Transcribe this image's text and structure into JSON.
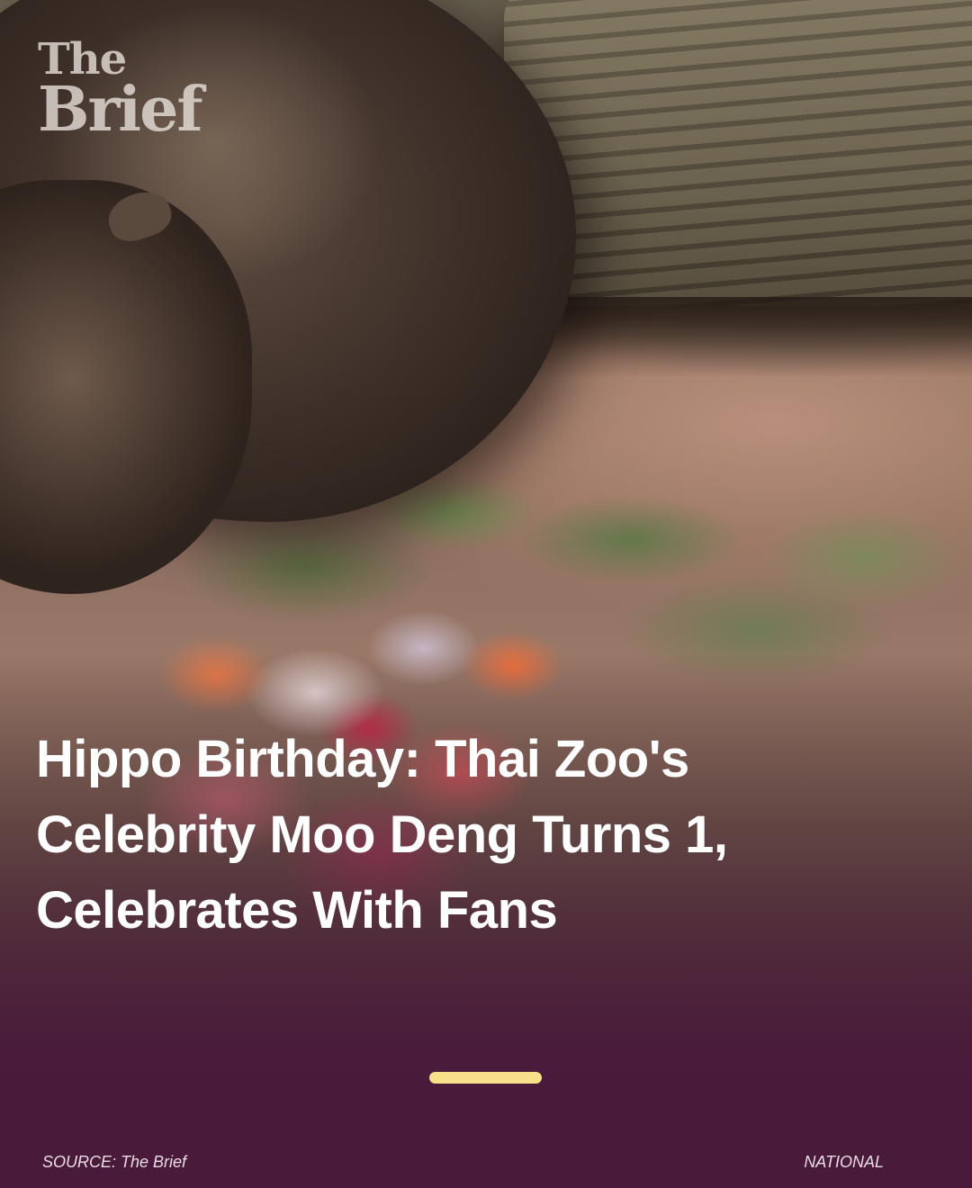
{
  "brand": {
    "logo_line1": "The",
    "logo_line2": "Brief"
  },
  "article": {
    "headline_lines": [
      "Hippo Birthday: Thai Zoo's",
      "Celebrity Moo Deng Turns 1,",
      "Celebrates With Fans"
    ]
  },
  "footer": {
    "source": "SOURCE: The Brief",
    "category": "NATIONAL"
  },
  "colors": {
    "background": "#4a1a3a",
    "indicator": "#f6e08a",
    "headline": "#ffffff"
  }
}
